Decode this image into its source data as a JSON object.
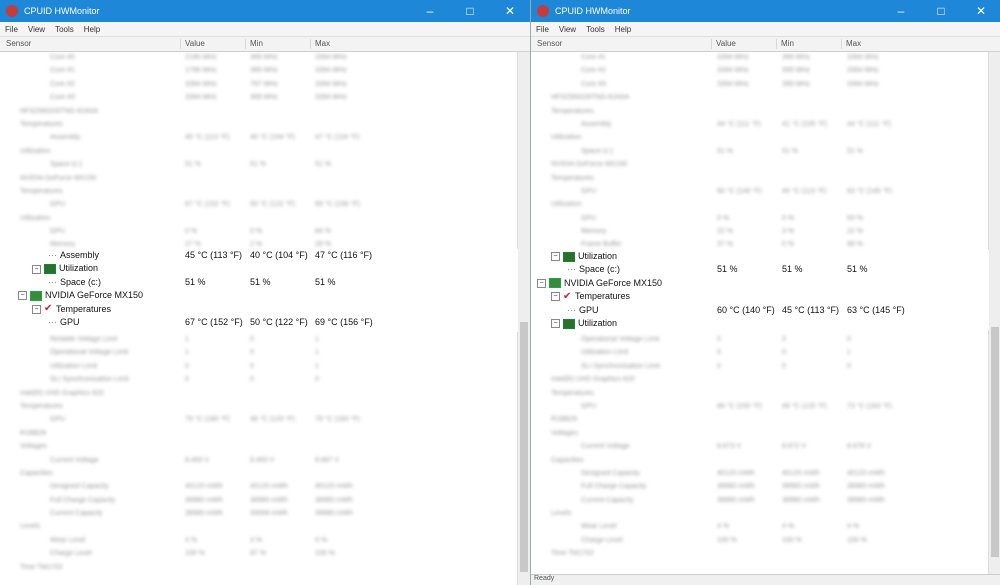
{
  "left": {
    "title": "CPUID HWMonitor",
    "menu": [
      "File",
      "View",
      "Tools",
      "Help"
    ],
    "columns": [
      "Sensor",
      "Value",
      "Min",
      "Max"
    ],
    "blurred_top": [
      {
        "label": "Core #0",
        "v": "2195 MHz",
        "min": "399 MHz",
        "max": "3394 MHz"
      },
      {
        "label": "Core #1",
        "v": "1796 MHz",
        "min": "399 MHz",
        "max": "3394 MHz"
      },
      {
        "label": "Core #2",
        "v": "3394 MHz",
        "min": "797 MHz",
        "max": "3394 MHz"
      },
      {
        "label": "Core #3",
        "v": "3394 MHz",
        "min": "399 MHz",
        "max": "3394 MHz"
      },
      {
        "label": "HFS256GD9TNG-62A0A",
        "v": "",
        "min": "",
        "max": ""
      },
      {
        "label": "Temperatures",
        "v": "",
        "min": "",
        "max": ""
      },
      {
        "label": "Assembly",
        "v": "45 °C (113 °F)",
        "min": "40 °C (104 °F)",
        "max": "47 °C (116 °F)"
      },
      {
        "label": "Utilization",
        "v": "",
        "min": "",
        "max": ""
      },
      {
        "label": "Space (c:)",
        "v": "51 %",
        "min": "51 %",
        "max": "51 %"
      },
      {
        "label": "NVIDIA GeForce MX150",
        "v": "",
        "min": "",
        "max": ""
      },
      {
        "label": "Temperatures",
        "v": "",
        "min": "",
        "max": ""
      },
      {
        "label": "GPU",
        "v": "67 °C (152 °F)",
        "min": "50 °C (122 °F)",
        "max": "69 °C (156 °F)"
      },
      {
        "label": "Utilization",
        "v": "",
        "min": "",
        "max": ""
      },
      {
        "label": "GPU",
        "v": "0 %",
        "min": "0 %",
        "max": "84 %"
      },
      {
        "label": "Memory",
        "v": "27 %",
        "min": "2 %",
        "max": "28 %"
      }
    ],
    "sharp": {
      "assembly": {
        "label": "Assembly",
        "v": "45 °C (113 °F)",
        "min": "40 °C (104 °F)",
        "max": "47 °C (116 °F)"
      },
      "utilization": "Utilization",
      "space": {
        "label": "Space (c:)",
        "v": "51 %",
        "min": "51 %",
        "max": "51 %"
      },
      "gpu_name": "NVIDIA GeForce MX150",
      "temperatures": "Temperatures",
      "gpu": {
        "label": "GPU",
        "v": "67 °C (152 °F)",
        "min": "50 °C (122 °F)",
        "max": "69 °C (156 °F)"
      }
    },
    "blurred_bottom": [
      {
        "label": "Reliable Voltage Limit",
        "v": "1",
        "min": "0",
        "max": "1"
      },
      {
        "label": "Operational Voltage Limit",
        "v": "1",
        "min": "0",
        "max": "1"
      },
      {
        "label": "Utilization Limit",
        "v": "0",
        "min": "0",
        "max": "1"
      },
      {
        "label": "SLI Synchronisation Limit",
        "v": "0",
        "min": "0",
        "max": "0"
      },
      {
        "label": "Intel(R) UHD Graphics 620",
        "v": "",
        "min": "",
        "max": ""
      },
      {
        "label": "Temperatures",
        "v": "",
        "min": "",
        "max": ""
      },
      {
        "label": "GPU",
        "v": "79 °C (180 °F)",
        "min": "48 °C (120 °F)",
        "max": "79 °C (183 °F)"
      },
      {
        "label": "R1BB29",
        "v": "",
        "min": "",
        "max": ""
      },
      {
        "label": "Voltages",
        "v": "",
        "min": "",
        "max": ""
      },
      {
        "label": "Current Voltage",
        "v": "8.493 V",
        "min": "8.493 V",
        "max": "8.687 V"
      },
      {
        "label": "Capacities",
        "v": "",
        "min": "",
        "max": ""
      },
      {
        "label": "Designed Capacity",
        "v": "40120 mWh",
        "min": "40120 mWh",
        "max": "40120 mWh"
      },
      {
        "label": "Full Charge Capacity",
        "v": "38980 mWh",
        "min": "38980 mWh",
        "max": "38980 mWh"
      },
      {
        "label": "Current Capacity",
        "v": "38980 mWh",
        "min": "33066 mWh",
        "max": "38980 mWh"
      },
      {
        "label": "Levels",
        "v": "",
        "min": "",
        "max": ""
      },
      {
        "label": "Wear Level",
        "v": "4 %",
        "min": "4 %",
        "max": "4 %"
      },
      {
        "label": "Charge Level",
        "v": "100 %",
        "min": "87 %",
        "max": "100 %"
      },
      {
        "label": "Time TM1702",
        "v": "",
        "min": "",
        "max": ""
      }
    ]
  },
  "right": {
    "title": "CPUID HWMonitor",
    "menu": [
      "File",
      "View",
      "Tools",
      "Help"
    ],
    "columns": [
      "Sensor",
      "Value",
      "Min",
      "Max"
    ],
    "blurred_top": [
      {
        "label": "Core #1",
        "v": "3394 MHz",
        "min": "399 MHz",
        "max": "3394 MHz"
      },
      {
        "label": "Core #2",
        "v": "3394 MHz",
        "min": "399 MHz",
        "max": "3394 MHz"
      },
      {
        "label": "Core #3",
        "v": "3394 MHz",
        "min": "399 MHz",
        "max": "3394 MHz"
      },
      {
        "label": "HFS256GD9TNG-62A0A",
        "v": "",
        "min": "",
        "max": ""
      },
      {
        "label": "Temperatures",
        "v": "",
        "min": "",
        "max": ""
      },
      {
        "label": "Assembly",
        "v": "44 °C (111 °F)",
        "min": "41 °C (105 °F)",
        "max": "44 °C (111 °F)"
      },
      {
        "label": "Utilization",
        "v": "",
        "min": "",
        "max": ""
      },
      {
        "label": "Space (c:)",
        "v": "51 %",
        "min": "51 %",
        "max": "51 %"
      },
      {
        "label": "NVIDIA GeForce MX150",
        "v": "",
        "min": "",
        "max": ""
      },
      {
        "label": "Temperatures",
        "v": "",
        "min": "",
        "max": ""
      },
      {
        "label": "GPU",
        "v": "60 °C (140 °F)",
        "min": "45 °C (113 °F)",
        "max": "63 °C (145 °F)"
      },
      {
        "label": "Utilization",
        "v": "",
        "min": "",
        "max": ""
      },
      {
        "label": "GPU",
        "v": "0 %",
        "min": "0 %",
        "max": "63 %"
      },
      {
        "label": "Memory",
        "v": "22 %",
        "min": "3 %",
        "max": "22 %"
      },
      {
        "label": "Frame Buffer",
        "v": "37 %",
        "min": "0 %",
        "max": "68 %"
      }
    ],
    "sharp": {
      "utilization_top": "Utilization",
      "space": {
        "label": "Space (c:)",
        "v": "51 %",
        "min": "51 %",
        "max": "51 %"
      },
      "gpu_name": "NVIDIA GeForce MX150",
      "temperatures": "Temperatures",
      "gpu": {
        "label": "GPU",
        "v": "60 °C (140 °F)",
        "min": "45 °C (113 °F)",
        "max": "63 °C (145 °F)"
      },
      "utilization": "Utilization"
    },
    "blurred_bottom": [
      {
        "label": "Operational Voltage Limit",
        "v": "0",
        "min": "0",
        "max": "0"
      },
      {
        "label": "Utilization Limit",
        "v": "0",
        "min": "0",
        "max": "1"
      },
      {
        "label": "SLI Synchronisation Limit",
        "v": "0",
        "min": "0",
        "max": "0"
      },
      {
        "label": "Intel(R) UHD Graphics 620",
        "v": "",
        "min": "",
        "max": ""
      },
      {
        "label": "Temperatures",
        "v": "",
        "min": "",
        "max": ""
      },
      {
        "label": "GPU",
        "v": "66 °C (150 °F)",
        "min": "49 °C (120 °F)",
        "max": "73 °C (163 °F)"
      },
      {
        "label": "R1BB29",
        "v": "",
        "min": "",
        "max": ""
      },
      {
        "label": "Voltages",
        "v": "",
        "min": "",
        "max": ""
      },
      {
        "label": "Current Voltage",
        "v": "8.673 V",
        "min": "8.672 V",
        "max": "8.678 V"
      },
      {
        "label": "Capacities",
        "v": "",
        "min": "",
        "max": ""
      },
      {
        "label": "Designed Capacity",
        "v": "40120 mWh",
        "min": "40120 mWh",
        "max": "40120 mWh"
      },
      {
        "label": "Full Charge Capacity",
        "v": "38980 mWh",
        "min": "38980 mWh",
        "max": "38980 mWh"
      },
      {
        "label": "Current Capacity",
        "v": "38980 mWh",
        "min": "38980 mWh",
        "max": "38980 mWh"
      },
      {
        "label": "Levels",
        "v": "",
        "min": "",
        "max": ""
      },
      {
        "label": "Wear Level",
        "v": "4 %",
        "min": "4 %",
        "max": "4 %"
      },
      {
        "label": "Charge Level",
        "v": "100 %",
        "min": "100 %",
        "max": "100 %"
      },
      {
        "label": "Time TM1702",
        "v": "",
        "min": "",
        "max": ""
      }
    ],
    "status": "Ready"
  }
}
